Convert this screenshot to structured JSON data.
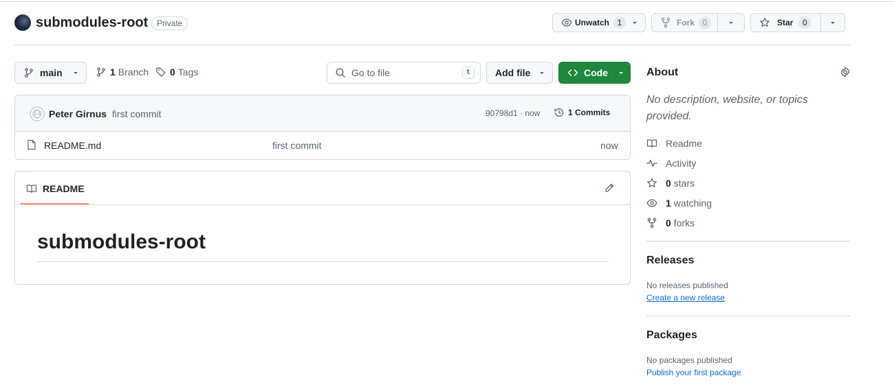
{
  "repo": {
    "name": "submodules-root",
    "visibility": "Private"
  },
  "actions": {
    "watch_label": "Unwatch",
    "watch_count": "1",
    "fork_label": "Fork",
    "fork_count": "0",
    "star_label": "Star",
    "star_count": "0"
  },
  "toolbar": {
    "branch": "main",
    "branch_count": "1",
    "branch_label": "Branch",
    "tag_count": "0",
    "tag_label": "Tags",
    "search_placeholder": "Go to file",
    "search_shortcut": "t",
    "add_file_label": "Add file",
    "code_label": "Code"
  },
  "commit": {
    "author": "Peter Girnus",
    "message": "first commit",
    "hash_time": "90798d1 · now",
    "commits_label": "1 Commits"
  },
  "files": [
    {
      "name": "README.md",
      "message": "first commit",
      "time": "now"
    }
  ],
  "readme": {
    "tab_label": "README",
    "heading": "submodules-root"
  },
  "about": {
    "title": "About",
    "description": "No description, website, or topics provided.",
    "items": [
      {
        "icon": "book-icon",
        "count": "",
        "label": "Readme"
      },
      {
        "icon": "pulse-icon",
        "count": "",
        "label": "Activity"
      },
      {
        "icon": "star-icon",
        "count": "0",
        "label": "stars"
      },
      {
        "icon": "eye-icon",
        "count": "1",
        "label": "watching"
      },
      {
        "icon": "fork-icon",
        "count": "0",
        "label": "forks"
      }
    ]
  },
  "releases": {
    "title": "Releases",
    "empty": "No releases published",
    "link": "Create a new release"
  },
  "packages": {
    "title": "Packages",
    "empty": "No packages published",
    "link": "Publish your first package"
  },
  "colors": {
    "primary_green": "#1f883d",
    "link_blue": "#0969da",
    "border": "#d1d9e0",
    "muted_text": "#59636e",
    "tab_accent": "#fd8c73"
  }
}
